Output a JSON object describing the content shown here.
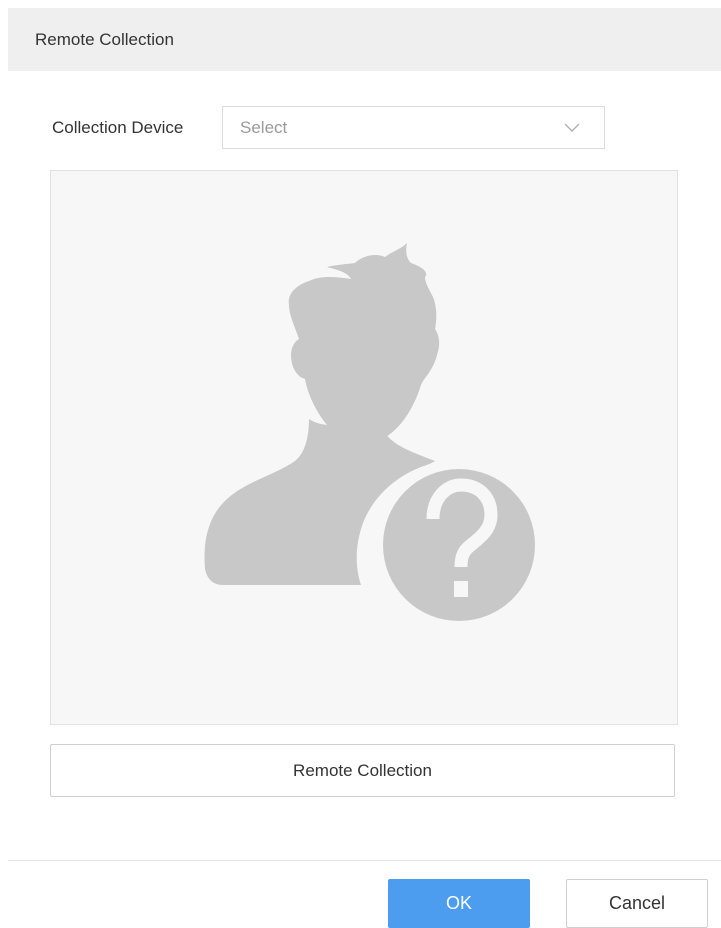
{
  "dialog": {
    "title": "Remote Collection"
  },
  "device": {
    "label": "Collection Device",
    "placeholder": "Select",
    "dropdown_icon": "chevron-down-icon"
  },
  "photo": {
    "placeholder_icon": "unknown-person-icon",
    "placeholder_color": "#c8c8c8",
    "background_color": "#f7f7f7"
  },
  "actions": {
    "collect_label": "Remote Collection",
    "ok_label": "OK",
    "cancel_label": "Cancel"
  },
  "colors": {
    "primary": "#4c9df0",
    "header_bg": "#efefef"
  }
}
